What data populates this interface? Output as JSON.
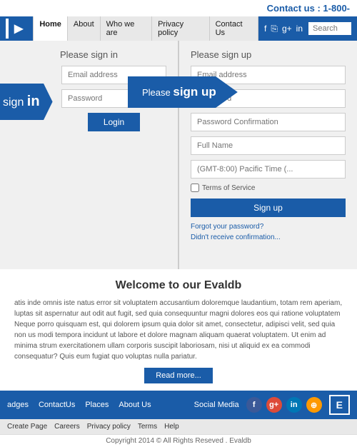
{
  "topbar": {
    "contact_label": "Contact us :",
    "contact_number": "1-800-"
  },
  "nav": {
    "logo": "▶",
    "links": [
      {
        "label": "Home",
        "active": true
      },
      {
        "label": "About"
      },
      {
        "label": "Who we are"
      },
      {
        "label": "Privacy policy"
      },
      {
        "label": "Contact Us"
      }
    ],
    "social": [
      "f",
      "🔔",
      "g+",
      "in"
    ],
    "search_placeholder": "Search"
  },
  "signin": {
    "title": "Please sign in",
    "arrow_light": "sign ",
    "arrow_bold": "in",
    "email_placeholder": "Email address",
    "password_placeholder": "Password",
    "login_btn": "Login"
  },
  "middle_arrow": {
    "light": "Please ",
    "bold": "sign up"
  },
  "signup": {
    "title": "Please sign up",
    "email_placeholder": "Email address",
    "password_placeholder": "Password",
    "confirm_placeholder": "Password Confirmation",
    "fullname_placeholder": "Full Name",
    "timezone_placeholder": "(GMT-8:00) Pacific Time (...",
    "terms_label": "Terms of Service",
    "signup_btn": "Sign up",
    "forgot_link": "Forgot your password?",
    "resend_link": "Didn't receive confirmation..."
  },
  "welcome": {
    "title_light": "Welcome to our ",
    "title_bold": "Evaldb",
    "body": "atis inde omnis iste natus error sit voluptatem accusantium doloremque laudantium, totam rem aperiam, luptas sit aspernatur aut odit aut fugit, sed quia consequuntur magni dolores eos qui ratione voluptatem Neque porro quisquam est, qui dolorem ipsum quia dolor sit amet, consectetur, adipisci velit, sed quia non us modi tempora incidunt ut labore et dolore magnam aliquam quaerat voluptatem. Ut enim ad minima strum exercitationem ullam corporis suscipit laboriosam, nisi ut aliquid ex ea commodi consequatur? Quis eum fugiat quo voluptas nulla pariatur.",
    "read_more": "Read more..."
  },
  "footer_nav": {
    "items": [
      "adges",
      "ContactUs",
      "Places",
      "About Us",
      "Social Media"
    ]
  },
  "footer_links": {
    "items": [
      "Create Page",
      "Careers",
      "Privacy policy",
      "Terms",
      "Help"
    ]
  },
  "footer_copy": {
    "text": "Copyright 2014 © All Rights Reseved . Evaldb"
  },
  "social_icons": [
    {
      "name": "facebook-icon",
      "letter": "f",
      "class": "si-fb"
    },
    {
      "name": "googleplus-icon",
      "letter": "g+",
      "class": "si-gp"
    },
    {
      "name": "linkedin-icon",
      "letter": "in",
      "class": "si-li"
    },
    {
      "name": "rss-icon",
      "letter": "⊕",
      "class": "si-rss"
    }
  ]
}
